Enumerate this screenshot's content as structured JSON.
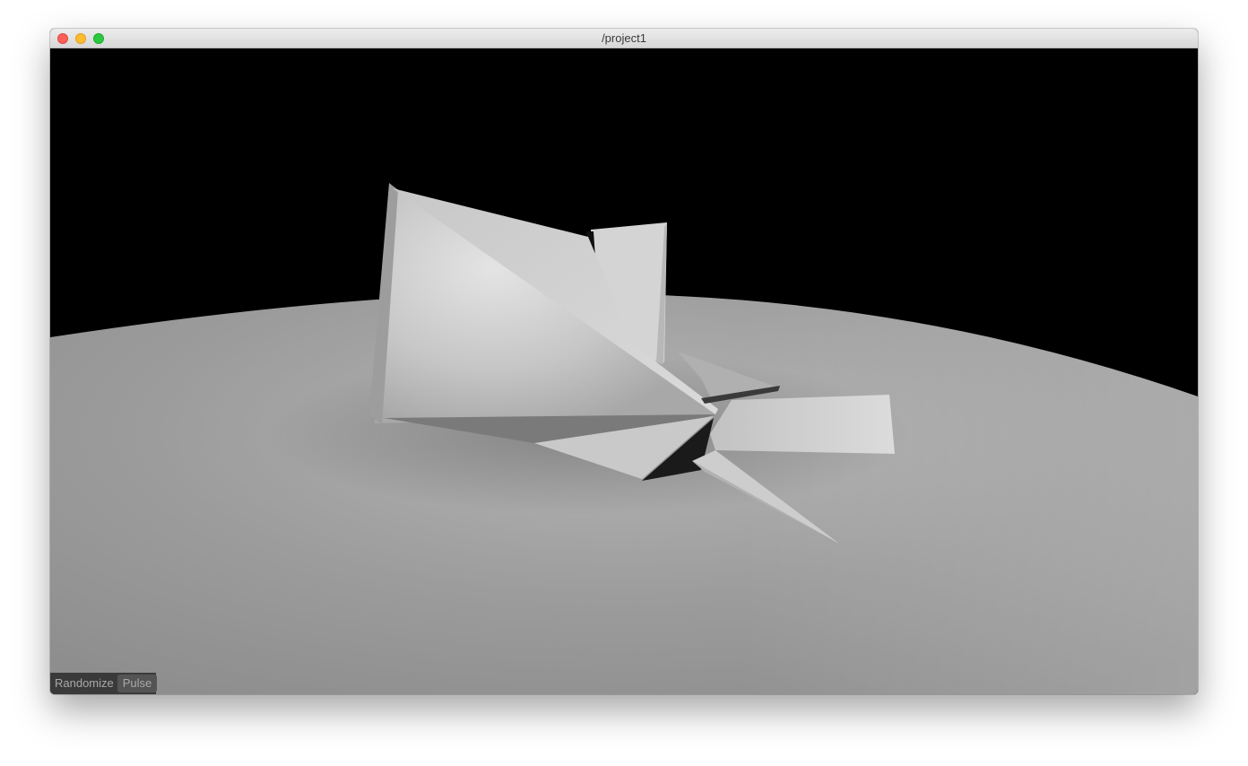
{
  "window": {
    "title": "/project1",
    "controls": {
      "close": "close-icon",
      "minimize": "minimize-icon",
      "maximize": "maximize-icon"
    }
  },
  "viewport": {
    "background": "#000000",
    "floor_color": "#9a9a9a"
  },
  "gui": {
    "randomize_label": "Randomize",
    "pulse_label": "Pulse"
  }
}
